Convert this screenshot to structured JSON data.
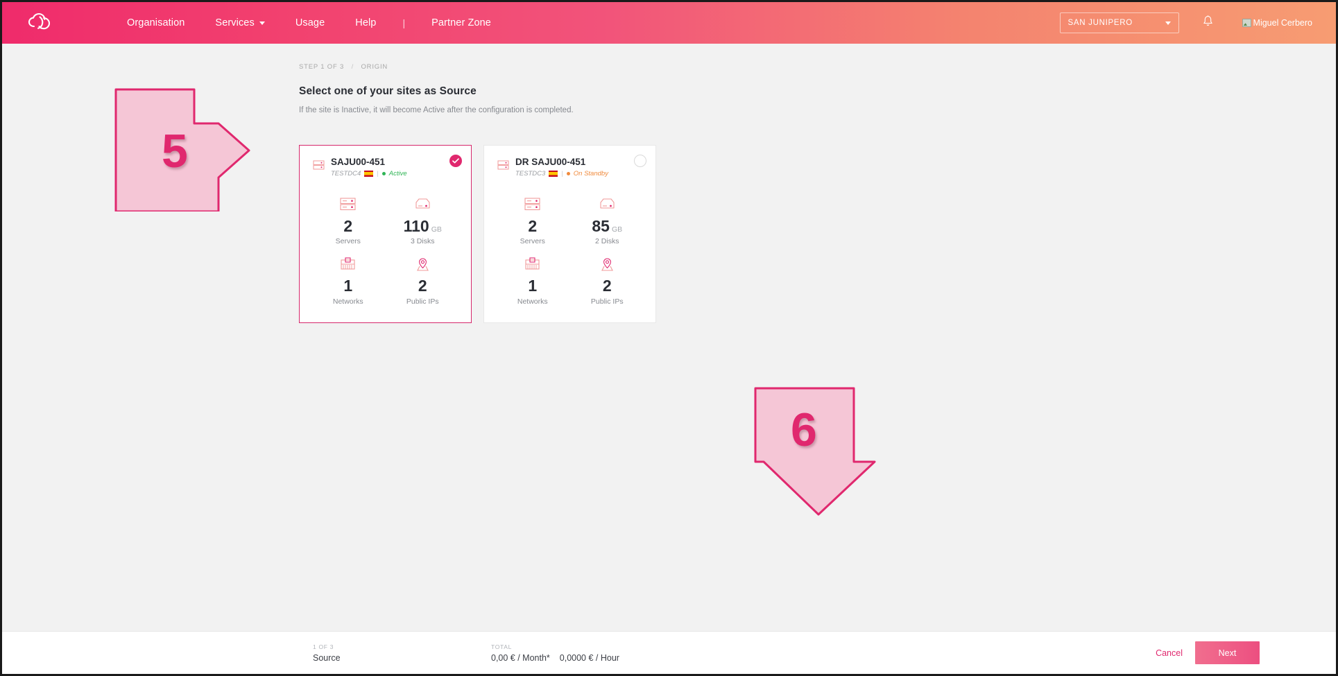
{
  "header": {
    "logo_icon": "cloud-logo-icon",
    "nav": [
      {
        "label": "Organisation",
        "has_caret": false
      },
      {
        "label": "Services",
        "has_caret": true
      },
      {
        "label": "Usage",
        "has_caret": false
      },
      {
        "label": "Help",
        "has_caret": false
      },
      {
        "label": "Partner Zone",
        "has_caret": false
      }
    ],
    "separator": "|",
    "org_selector": {
      "value": "SAN JUNIPERO",
      "icon": "chevron-down-icon"
    },
    "notifications_icon": "bell-icon",
    "user": {
      "name": "Miguel Cerbero",
      "avatar_icon": "broken-image-icon"
    }
  },
  "breadcrumb": {
    "step": "STEP 1 OF 3",
    "separator": "/",
    "section": "ORIGIN"
  },
  "page": {
    "title": "Select one of your sites as Source",
    "subtitle": "If the site is Inactive, it will become Active after the configuration is completed."
  },
  "cards": [
    {
      "name": "SAJU00-451",
      "datacenter": "TESTDC4",
      "country_flag": "spain-flag-icon",
      "separator": "|",
      "status": "Active",
      "status_color": "#2fb455",
      "selected": true,
      "select_icon": "check-circle-icon",
      "stats": [
        {
          "icon": "server-rack-icon",
          "value": "2",
          "unit": "",
          "label": "Servers"
        },
        {
          "icon": "disk-icon",
          "value": "110",
          "unit": "GB",
          "label": "3 Disks"
        },
        {
          "icon": "network-icon",
          "value": "1",
          "unit": "",
          "label": "Networks"
        },
        {
          "icon": "location-pin-icon",
          "value": "2",
          "unit": "",
          "label": "Public IPs"
        }
      ]
    },
    {
      "name": "DR SAJU00-451",
      "datacenter": "TESTDC3",
      "country_flag": "spain-flag-icon",
      "separator": "|",
      "status": "On Standby",
      "status_color": "#f08a3c",
      "selected": false,
      "select_icon": "radio-empty-icon",
      "stats": [
        {
          "icon": "server-rack-icon",
          "value": "2",
          "unit": "",
          "label": "Servers"
        },
        {
          "icon": "disk-icon",
          "value": "85",
          "unit": "GB",
          "label": "2 Disks"
        },
        {
          "icon": "network-icon",
          "value": "1",
          "unit": "",
          "label": "Networks"
        },
        {
          "icon": "location-pin-icon",
          "value": "2",
          "unit": "",
          "label": "Public IPs"
        }
      ]
    }
  ],
  "footer": {
    "step_caption": "1 OF 3",
    "step_value": "Source",
    "total_caption": "TOTAL",
    "price_month": "0,00 € / Month*",
    "price_hour": "0,0000 € / Hour",
    "cancel_label": "Cancel",
    "next_label": "Next"
  },
  "annotations": [
    {
      "number": "5",
      "shape": "arrow-right",
      "target": "source-site-card"
    },
    {
      "number": "6",
      "shape": "arrow-down",
      "target": "next-button"
    }
  ],
  "colors": {
    "brand_pink": "#e0286e",
    "annotation_fill": "#f5c6d6",
    "annotation_stroke": "#e0286e"
  }
}
